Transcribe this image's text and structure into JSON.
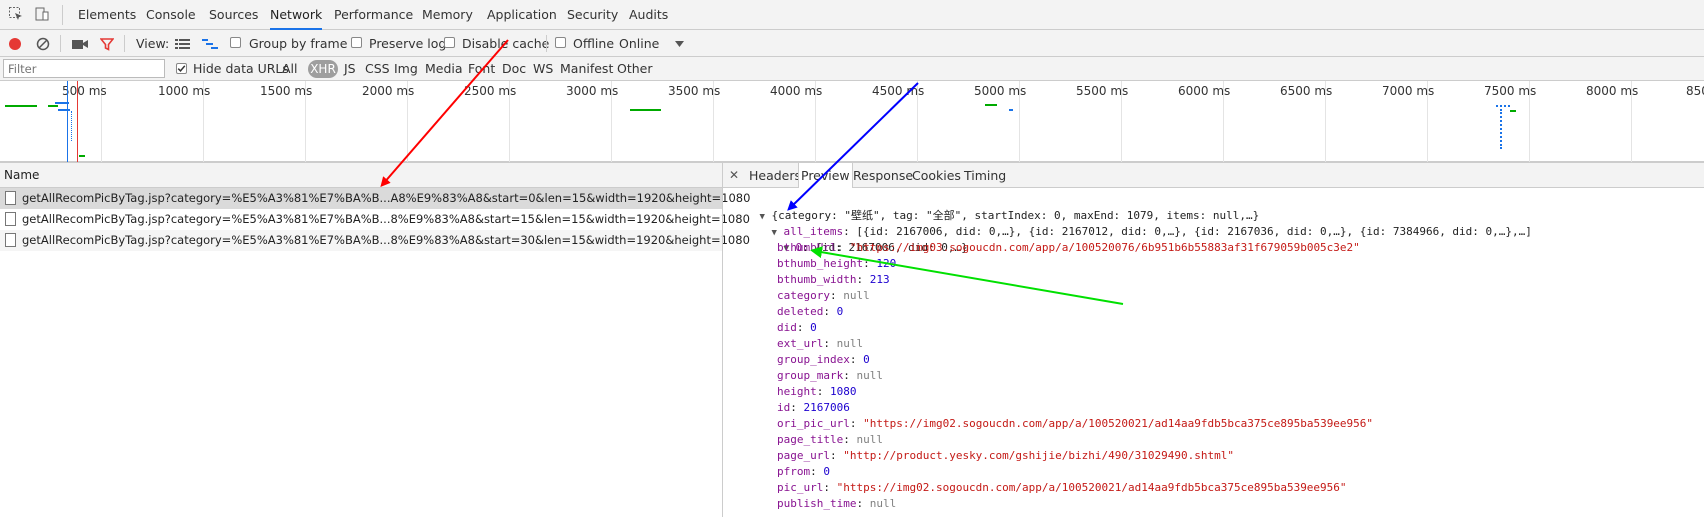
{
  "tabs": [
    "Elements",
    "Console",
    "Sources",
    "Network",
    "Performance",
    "Memory",
    "Application",
    "Security",
    "Audits"
  ],
  "active_tab": "Network",
  "toolbar": {
    "view_label": "View:",
    "group_by_frame": "Group by frame",
    "preserve_log": "Preserve log",
    "disable_cache": "Disable cache",
    "offline": "Offline",
    "throttle": "Online"
  },
  "filter": {
    "placeholder": "Filter",
    "hide_data_urls": "Hide data URLs",
    "types": [
      "All",
      "XHR",
      "JS",
      "CSS",
      "Img",
      "Media",
      "Font",
      "Doc",
      "WS",
      "Manifest",
      "Other"
    ],
    "active_type": "XHR"
  },
  "timeline_labels": [
    "500 ms",
    "1000 ms",
    "1500 ms",
    "2000 ms",
    "2500 ms",
    "3000 ms",
    "3500 ms",
    "4000 ms",
    "4500 ms",
    "5000 ms",
    "5500 ms",
    "6000 ms",
    "6500 ms",
    "7000 ms",
    "7500 ms",
    "8000 ms",
    "850"
  ],
  "requests": {
    "header": "Name",
    "rows": [
      "getAllRecomPicByTag.jsp?category=%E5%A3%81%E7%BA%B...A8%E9%83%A8&start=0&len=15&width=1920&height=1080",
      "getAllRecomPicByTag.jsp?category=%E5%A3%81%E7%BA%B...8%E9%83%A8&start=15&len=15&width=1920&height=1080",
      "getAllRecomPicByTag.jsp?category=%E5%A3%81%E7%BA%B...8%E9%83%A8&start=30&len=15&width=1920&height=1080"
    ]
  },
  "detail_tabs": [
    "Headers",
    "Preview",
    "Response",
    "Cookies",
    "Timing"
  ],
  "active_detail_tab": "Preview",
  "preview": {
    "root_summary": "{category: \"壁纸\", tag: \"全部\", startIndex: 0, maxEnd: 1079, items: null,…}",
    "all_items_key": "all_items",
    "all_items_summary": "[{id: 2167006, did: 0,…}, {id: 2167012, did: 0,…}, {id: 2167036, did: 0,…}, {id: 7384966, did: 0,…},…]",
    "item0_key": "0",
    "item0_summary": "{id: 2167006, did: 0,…}",
    "props": [
      {
        "key": "bthumbUrl",
        "value": "\"https://img03.sogoucdn.com/app/a/100520076/6b951b6b55883af31f679059b005c3e2\"",
        "kind": "s"
      },
      {
        "key": "bthumb_height",
        "value": "120",
        "kind": "n"
      },
      {
        "key": "bthumb_width",
        "value": "213",
        "kind": "n"
      },
      {
        "key": "category",
        "value": "null",
        "kind": "nl"
      },
      {
        "key": "deleted",
        "value": "0",
        "kind": "n"
      },
      {
        "key": "did",
        "value": "0",
        "kind": "n"
      },
      {
        "key": "ext_url",
        "value": "null",
        "kind": "nl"
      },
      {
        "key": "group_index",
        "value": "0",
        "kind": "n"
      },
      {
        "key": "group_mark",
        "value": "null",
        "kind": "nl"
      },
      {
        "key": "height",
        "value": "1080",
        "kind": "n"
      },
      {
        "key": "id",
        "value": "2167006",
        "kind": "n"
      },
      {
        "key": "ori_pic_url",
        "value": "\"https://img02.sogoucdn.com/app/a/100520021/ad14aa9fdb5bca375ce895ba539ee956\"",
        "kind": "s"
      },
      {
        "key": "page_title",
        "value": "null",
        "kind": "nl"
      },
      {
        "key": "page_url",
        "value": "\"http://product.yesky.com/gshijie/bizhi/490/31029490.shtml\"",
        "kind": "s"
      },
      {
        "key": "pfrom",
        "value": "0",
        "kind": "n"
      },
      {
        "key": "pic_url",
        "value": "\"https://img02.sogoucdn.com/app/a/100520021/ad14aa9fdb5bca375ce895ba539ee956\"",
        "kind": "s"
      },
      {
        "key": "publish_time",
        "value": "null",
        "kind": "nl"
      }
    ]
  },
  "colors": {
    "record": "#e53935",
    "accent": "#1a73e8",
    "json_key": "#881391",
    "json_string": "#c41a16",
    "json_number": "#1c00cf",
    "arrow_red": "#ff0000",
    "arrow_blue": "#0000ff",
    "arrow_green": "#00e000"
  }
}
